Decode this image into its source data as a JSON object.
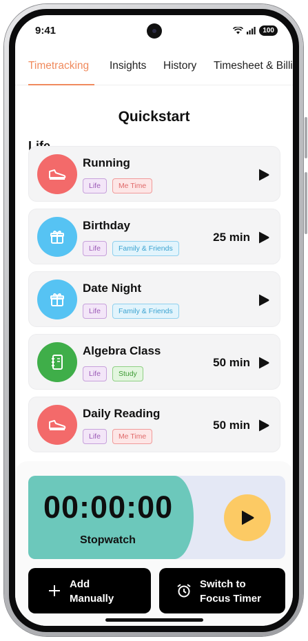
{
  "status_bar": {
    "time": "9:41",
    "battery": "100"
  },
  "tabs": [
    {
      "label": "Timetracking",
      "active": true
    },
    {
      "label": "Insights"
    },
    {
      "label": "History"
    },
    {
      "label": "Timesheet & Billi"
    }
  ],
  "quickstart": {
    "title": "Quickstart",
    "group": "Life",
    "items": [
      {
        "title": "Running",
        "icon": "shoe-icon",
        "color": "#f36a6a",
        "tags": [
          "Life",
          "Me Time"
        ],
        "duration": ""
      },
      {
        "title": "Birthday",
        "icon": "gift-icon",
        "color": "#56c3f3",
        "tags": [
          "Life",
          "Family & Friends"
        ],
        "duration": "25 min"
      },
      {
        "title": "Date Night",
        "icon": "gift-icon",
        "color": "#56c3f3",
        "tags": [
          "Life",
          "Family & Friends"
        ],
        "duration": ""
      },
      {
        "title": "Algebra Class",
        "icon": "notebook-icon",
        "color": "#3fae49",
        "tags": [
          "Life",
          "Study"
        ],
        "duration": "50 min"
      },
      {
        "title": "Daily Reading",
        "icon": "shoe-icon",
        "color": "#f36a6a",
        "tags": [
          "Life",
          "Me Time"
        ],
        "duration": "50 min"
      }
    ]
  },
  "stopwatch": {
    "time": "00:00:00",
    "label": "Stopwatch"
  },
  "actions": {
    "add_manually": "Add\nManually",
    "switch_focus": "Switch to\nFocus Timer"
  },
  "colors": {
    "accent": "#f08a5d",
    "stopwatch_green": "#6cc8bb",
    "play_yellow": "#fcca64"
  }
}
